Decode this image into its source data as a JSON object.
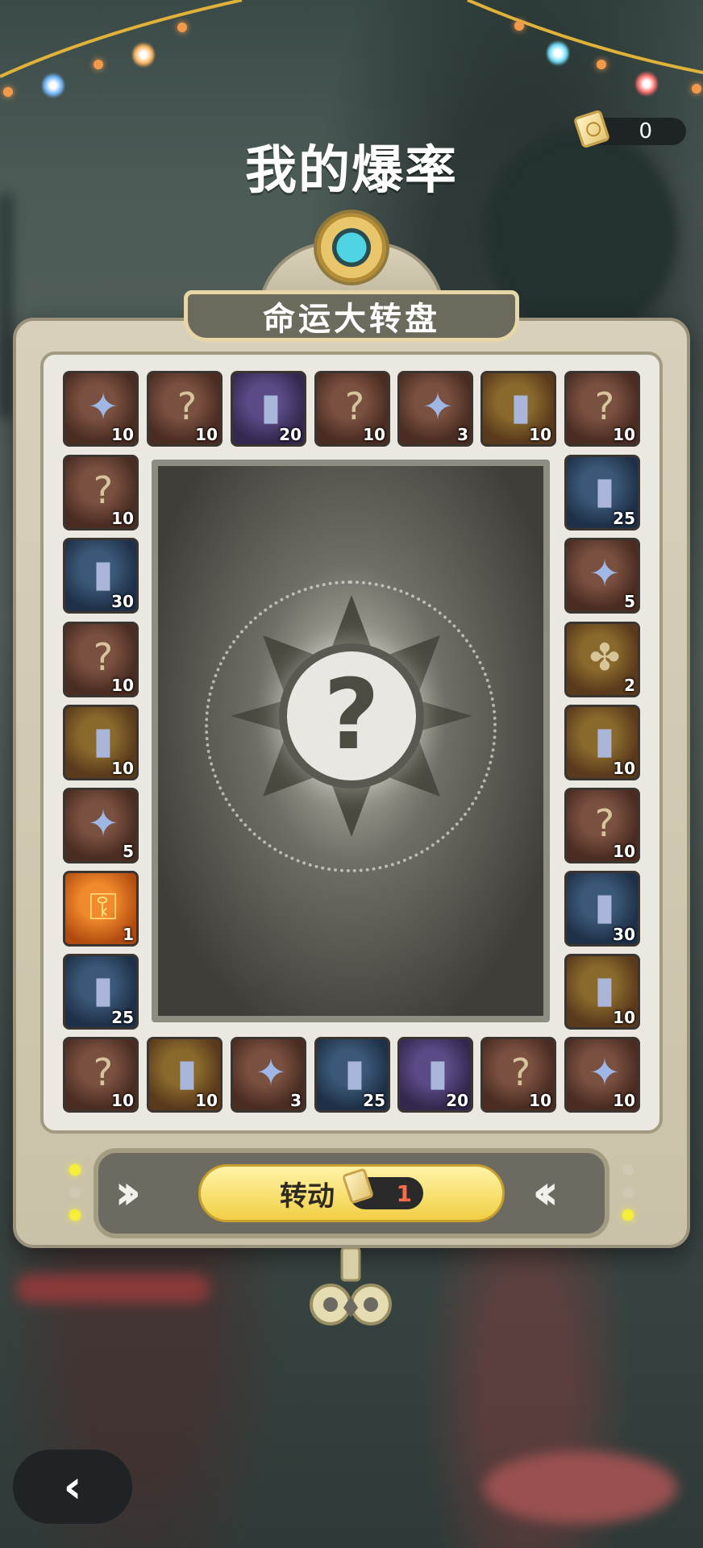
{
  "header": {
    "title": "我的爆率",
    "ticket_count": "0"
  },
  "wheel": {
    "name": "命运大转盘",
    "spin_label": "转动",
    "spin_cost": "1",
    "center_symbol": "?"
  },
  "icons": {
    "ticket": "ticket-icon",
    "back": "chevron-left-icon",
    "mystery": "question-mark-icon"
  },
  "items": {
    "top": [
      {
        "type": "star",
        "count": "10"
      },
      {
        "type": "badge",
        "count": "10"
      },
      {
        "type": "card-purple",
        "count": "20"
      },
      {
        "type": "badge",
        "count": "10"
      },
      {
        "type": "star",
        "count": "3"
      },
      {
        "type": "card-gold",
        "count": "10"
      },
      {
        "type": "badge",
        "count": "10"
      }
    ],
    "left": [
      {
        "type": "badge",
        "count": "10"
      },
      {
        "type": "card-blue",
        "count": "30"
      },
      {
        "type": "badge",
        "count": "10"
      },
      {
        "type": "card-gold",
        "count": "10"
      },
      {
        "type": "star",
        "count": "5"
      },
      {
        "type": "key",
        "count": "1"
      },
      {
        "type": "card-blue",
        "count": "25"
      }
    ],
    "right": [
      {
        "type": "card-blue",
        "count": "25"
      },
      {
        "type": "star",
        "count": "5"
      },
      {
        "type": "card-clover",
        "count": "2"
      },
      {
        "type": "card-gold",
        "count": "10"
      },
      {
        "type": "badge",
        "count": "10"
      },
      {
        "type": "card-blue",
        "count": "30"
      },
      {
        "type": "card-gold",
        "count": "10"
      }
    ],
    "bottom": [
      {
        "type": "badge",
        "count": "10"
      },
      {
        "type": "card-gold",
        "count": "10"
      },
      {
        "type": "star",
        "count": "3"
      },
      {
        "type": "card-blue",
        "count": "25"
      },
      {
        "type": "card-purple",
        "count": "20"
      },
      {
        "type": "badge",
        "count": "10"
      },
      {
        "type": "star",
        "count": "10"
      }
    ]
  }
}
